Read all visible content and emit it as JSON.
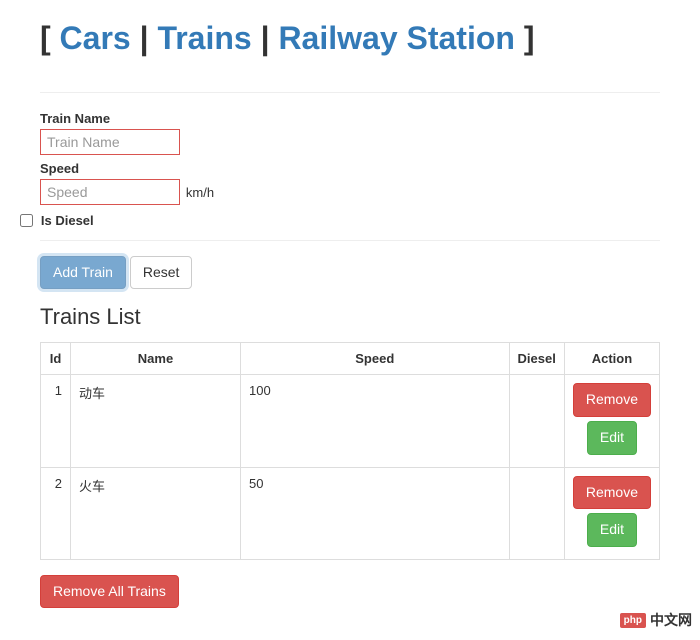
{
  "header": {
    "bracket_open": "[",
    "bracket_close": "]",
    "pipe": " | ",
    "links": [
      "Cars",
      "Trains",
      "Railway Station"
    ]
  },
  "form": {
    "train_name_label": "Train Name",
    "train_name_placeholder": "Train Name",
    "train_name_value": "",
    "speed_label": "Speed",
    "speed_placeholder": "Speed",
    "speed_value": "",
    "speed_suffix": "km/h",
    "is_diesel_label": "Is Diesel",
    "is_diesel_checked": false
  },
  "buttons": {
    "add_train": "Add Train",
    "reset": "Reset",
    "remove_all": "Remove All Trains"
  },
  "list": {
    "title": "Trains List",
    "columns": [
      "Id",
      "Name",
      "Speed",
      "Diesel",
      "Action"
    ],
    "rows": [
      {
        "id": "1",
        "name": "动车",
        "speed": "100",
        "diesel": ""
      },
      {
        "id": "2",
        "name": "火车",
        "speed": "50",
        "diesel": ""
      }
    ],
    "remove_label": "Remove",
    "edit_label": "Edit"
  },
  "watermark": {
    "logo": "php",
    "text": "中文网"
  }
}
